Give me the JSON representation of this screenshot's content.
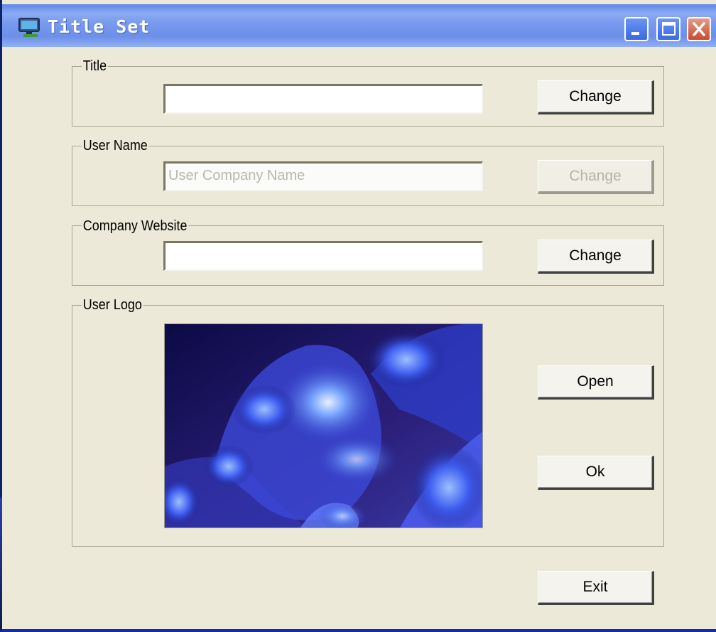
{
  "window": {
    "title": "Title Set",
    "icons": {
      "app": "computer-monitor-icon",
      "minimize": "minimize-icon",
      "maximize": "maximize-icon",
      "close": "close-icon"
    }
  },
  "title_group": {
    "label": "Title",
    "value": "",
    "button": "Change"
  },
  "username_group": {
    "label": "User Name",
    "placeholder": "User Company Name",
    "value": "User Company Name",
    "button": "Change",
    "disabled": true
  },
  "website_group": {
    "label": "Company Website",
    "value": "",
    "button": "Change"
  },
  "logo_group": {
    "label": "User Logo",
    "image": "blue-fractal-logo-image",
    "open_button": "Open",
    "ok_button": "Ok"
  },
  "exit_button": "Exit",
  "colors": {
    "titlebar": "#7899ee",
    "window_bg": "#ece9d8",
    "close_button": "#c94a2e",
    "disabled_text": "#b8b8b0"
  }
}
